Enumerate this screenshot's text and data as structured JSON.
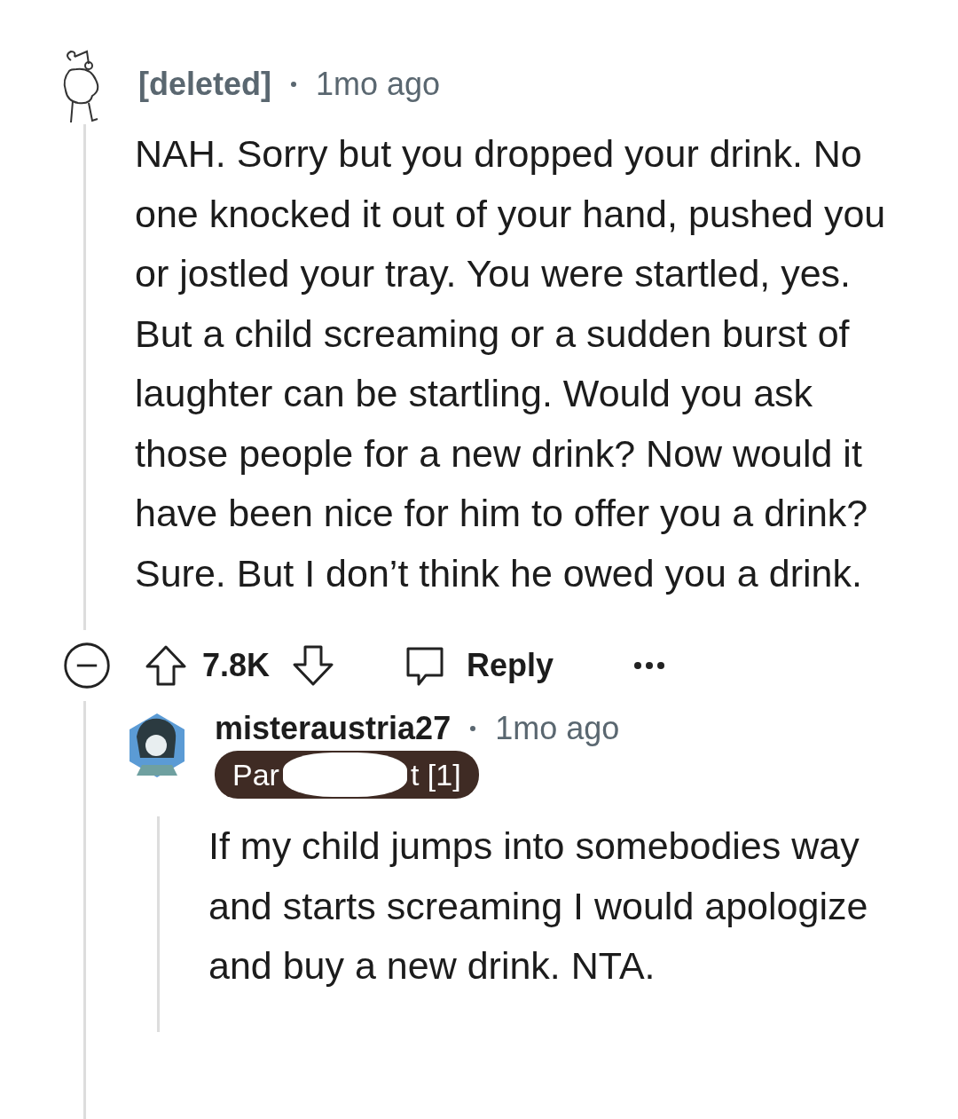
{
  "comment": {
    "author": "[deleted]",
    "time": "1mo ago",
    "body": "NAH. Sorry but you dropped your drink. No one knocked it out of your hand, pushed you or jostled your tray. You were startled, yes. But a child screaming or a sudden burst of laughter can be startling. Would you ask those people for a new drink? Now would it have been nice for him to offer you a drink? Sure. But I don’t think he owed you a drink.",
    "score": "7.8K",
    "reply_label": "Reply",
    "expanded": true
  },
  "reply": {
    "author": "misteraustria27",
    "time": "1mo ago",
    "flair_parts": [
      "Par",
      "t [1]"
    ],
    "body": "If my child jumps into somebodies way and starts screaming I would apologize and buy a new drink. NTA."
  }
}
